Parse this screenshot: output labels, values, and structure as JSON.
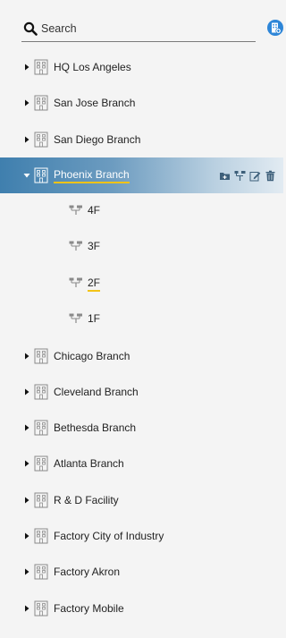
{
  "search": {
    "placeholder": "Search"
  },
  "tree": {
    "sites": [
      {
        "label": "HQ Los Angeles",
        "expanded": false
      },
      {
        "label": "San Jose Branch",
        "expanded": false
      },
      {
        "label": "San Diego Branch",
        "expanded": false
      },
      {
        "label": "Phoenix Branch",
        "expanded": true,
        "selected": true
      },
      {
        "label": "Chicago Branch",
        "expanded": false
      },
      {
        "label": "Cleveland Branch",
        "expanded": false
      },
      {
        "label": "Bethesda Branch",
        "expanded": false
      },
      {
        "label": "Atlanta Branch",
        "expanded": false
      },
      {
        "label": "R & D Facility",
        "expanded": false
      },
      {
        "label": "Factory City of Industry",
        "expanded": false
      },
      {
        "label": "Factory Akron",
        "expanded": false
      },
      {
        "label": "Factory Mobile",
        "expanded": false
      }
    ],
    "phoenix_floors": [
      {
        "label": "4F"
      },
      {
        "label": "3F"
      },
      {
        "label": "2F",
        "current": true
      },
      {
        "label": "1F"
      }
    ]
  },
  "colors": {
    "accent_blue": "#2e86d8",
    "selected_row": "#3f7fae",
    "highlight_underline": "#f3c318",
    "background": "#f4f4f4"
  },
  "icons": {
    "search": "search-icon",
    "add_site": "add-site-icon",
    "building": "building-icon",
    "floor": "floor-icon",
    "add_folder": "add-folder-icon",
    "hierarchy": "hierarchy-icon",
    "edit": "edit-icon",
    "delete": "trash-icon"
  }
}
